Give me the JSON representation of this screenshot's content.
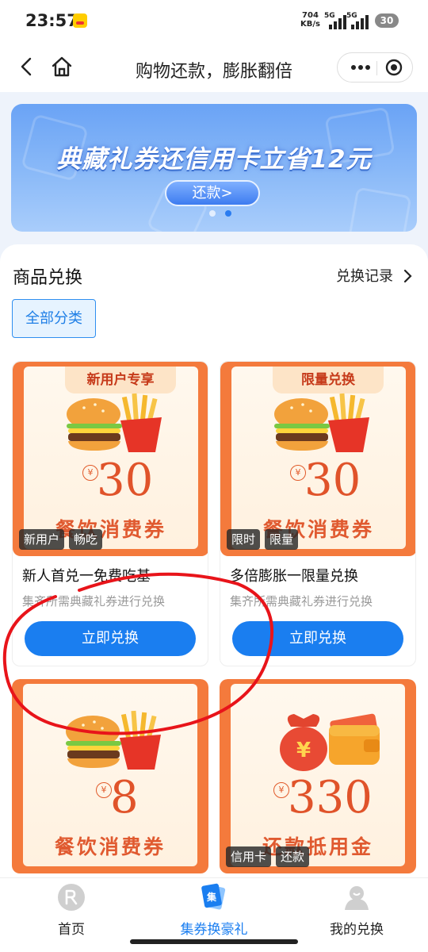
{
  "status": {
    "time": "23:57",
    "net_speed": "704",
    "net_unit": "KB/s",
    "sig1": "5G",
    "sig2": "5G",
    "battery": "30"
  },
  "header": {
    "title": "购物还款，膨胀翻倍"
  },
  "banner": {
    "title": "典藏礼券还信用卡立省12元",
    "button": "还款>"
  },
  "section": {
    "title": "商品兑换",
    "history_link": "兑换记录",
    "category_chip": "全部分类"
  },
  "products": [
    {
      "ribbon": "新用户专享",
      "price": "30",
      "coupon_name": "餐饮消费券",
      "badges": [
        "新用户",
        "畅吃"
      ],
      "title": "新人首兑一免费吃基",
      "subtitle": "集齐所需典藏礼券进行兑换",
      "button": "立即兑换"
    },
    {
      "ribbon": "限量兑换",
      "price": "30",
      "coupon_name": "餐饮消费券",
      "badges": [
        "限时",
        "限量"
      ],
      "title": "多倍膨胀一限量兑换",
      "subtitle": "集齐所需典藏礼券进行兑换",
      "button": "立即兑换"
    },
    {
      "ribbon": "",
      "price": "8",
      "coupon_name": "餐饮消费券",
      "badges": []
    },
    {
      "ribbon": "",
      "price": "330",
      "coupon_name": "还款抵用金",
      "badges": [
        "信用卡",
        "还款"
      ]
    }
  ],
  "currency_symbol": "¥",
  "nav": {
    "home": "首页",
    "collect": "集券换豪礼",
    "mine": "我的兑换"
  },
  "colors": {
    "accent": "#1a7ef0",
    "coupon_orange": "#f47a3c",
    "price_red": "#e0532a"
  }
}
